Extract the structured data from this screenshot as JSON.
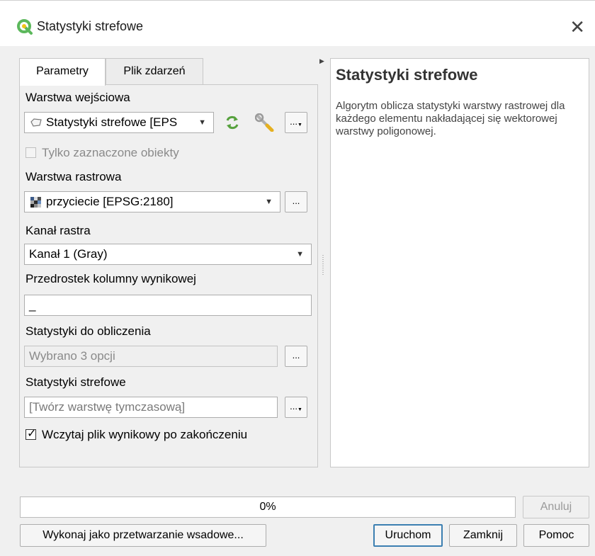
{
  "window": {
    "title": "Statystyki strefowe"
  },
  "tabs": [
    "Parametry",
    "Plik zdarzeń"
  ],
  "params": {
    "input_layer_label": "Warstwa wejściowa",
    "input_layer_value": "Statystyki strefowe [EPS",
    "selected_only_label": "Tylko zaznaczone obiekty",
    "raster_layer_label": "Warstwa rastrowa",
    "raster_layer_value": "przyciecie [EPSG:2180]",
    "band_label": "Kanał rastra",
    "band_value": "Kanał 1 (Gray)",
    "prefix_label": "Przedrostek kolumny wynikowej",
    "prefix_value": "_",
    "stats_label": "Statystyki do obliczenia",
    "stats_value": "Wybrano 3 opcji",
    "output_label": "Statystyki strefowe",
    "output_placeholder": "[Twórz warstwę tymczasową]",
    "load_output_label": "Wczytaj plik wynikowy po zakończeniu",
    "load_output_checked": true,
    "dots": "..."
  },
  "help": {
    "title": "Statystyki strefowe",
    "text": "Algorytm oblicza statystyki warstwy rastrowej dla każdego elementu nakładającej się wektorowej warstwy poligonowej."
  },
  "progress": {
    "text": "0%",
    "value": 0
  },
  "buttons": {
    "cancel": "Anuluj",
    "batch": "Wykonaj jako przetwarzanie wsadowe...",
    "run": "Uruchom",
    "close": "Zamknij",
    "help": "Pomoc"
  },
  "colors": {
    "qgis_green": "#5cb85c",
    "qgis_yellow": "#f0c419",
    "default_button_border": "#3c7fb1"
  }
}
